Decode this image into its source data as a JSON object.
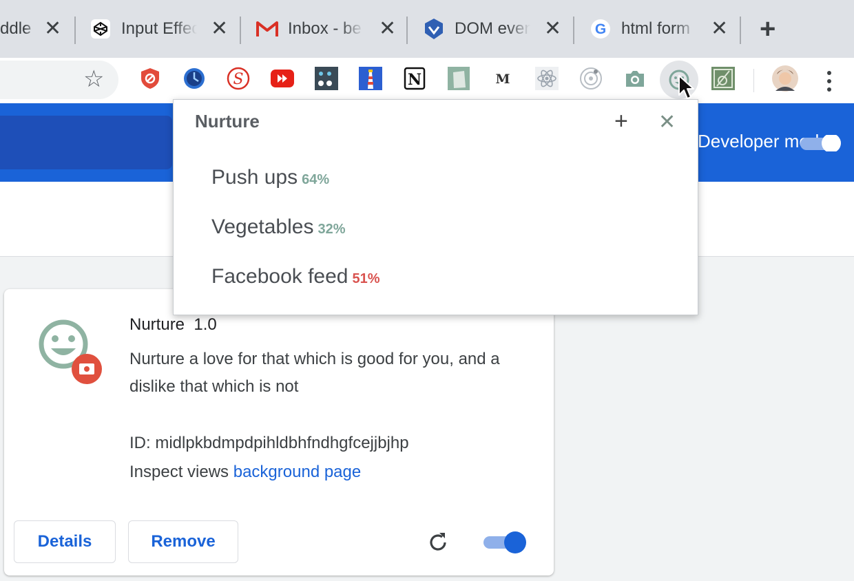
{
  "tabs": [
    {
      "title": "ddle",
      "icon": "jsfiddle-icon"
    },
    {
      "title": "Input Effects",
      "icon": "codepen-icon"
    },
    {
      "title": "Inbox - be",
      "icon": "gmail-icon"
    },
    {
      "title": "DOM even",
      "icon": "shield-logo-icon"
    },
    {
      "title": "html form",
      "icon": "google-icon"
    }
  ],
  "toolbar": {
    "extensions": [
      "ublock-icon",
      "clock-globe-icon",
      "script-s-icon",
      "youtube-icon",
      "dots-face-icon",
      "lighthouse-icon",
      "notion-icon",
      "paper-icon",
      "medium-icon",
      "react-icon",
      "target-icon",
      "camera-icon",
      "nurture-icon",
      "frame-icon"
    ]
  },
  "page": {
    "developer_mode_label": "Developer mode",
    "developer_mode_on": true
  },
  "popup": {
    "title": "Nurture",
    "habits": [
      {
        "name": "Push ups",
        "percent": "64%",
        "color": "#7fa69a"
      },
      {
        "name": "Vegetables",
        "percent": "32%",
        "color": "#7fa69a"
      },
      {
        "name": "Facebook feed",
        "percent": "51%",
        "color": "#d9534f"
      }
    ]
  },
  "extension": {
    "name": "Nurture",
    "version": "1.0",
    "description": "Nurture a love for that which is good for you, and a dislike that which is not",
    "id_label": "ID: midlpkbdmpdpihldbhfndhgfcejjbjhp",
    "inspect_prefix": "Inspect views ",
    "inspect_link": "background page",
    "details_label": "Details",
    "remove_label": "Remove",
    "enabled": true
  },
  "colors": {
    "accent": "#1a63d8",
    "nurture_green": "#7fa69a",
    "badge_red": "#e0503e"
  }
}
